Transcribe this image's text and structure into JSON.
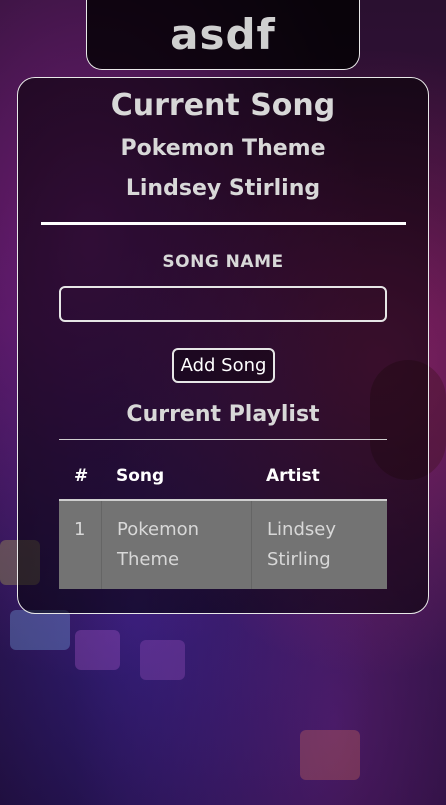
{
  "room": {
    "name": "asdf"
  },
  "current_song": {
    "heading": "Current Song",
    "title": "Pokemon Theme",
    "artist": "Lindsey Stirling"
  },
  "add_form": {
    "label": "SONG NAME",
    "input_value": "",
    "button_label": "Add Song"
  },
  "playlist": {
    "heading": "Current Playlist",
    "columns": [
      "#",
      "Song",
      "Artist"
    ],
    "rows": [
      {
        "index": "1",
        "song": "Pokemon Theme",
        "artist": "Lindsey Stirling"
      }
    ]
  }
}
